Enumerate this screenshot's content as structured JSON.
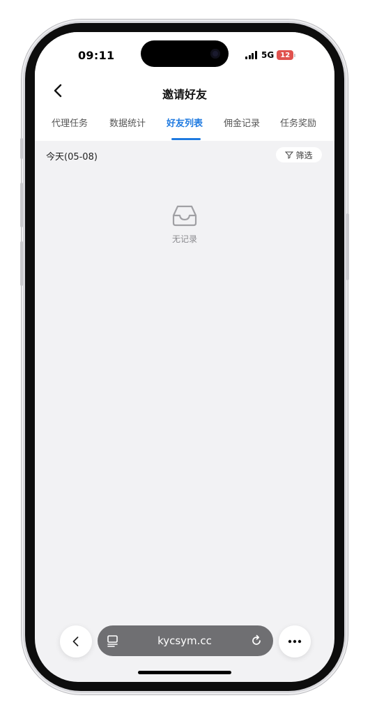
{
  "status_bar": {
    "time": "09:11",
    "network": "5G",
    "battery": "12"
  },
  "header": {
    "title": "邀请好友"
  },
  "tabs": [
    {
      "label": "代理任务"
    },
    {
      "label": "数据统计"
    },
    {
      "label": "好友列表",
      "active": true
    },
    {
      "label": "佣金记录"
    },
    {
      "label": "任务奖励"
    }
  ],
  "filter_row": {
    "date": "今天(05-08)",
    "filter_label": "筛选"
  },
  "empty_state": {
    "text": "无记录",
    "icon": "inbox-tray-icon"
  },
  "browser_bar": {
    "url": "kycsym.cc"
  },
  "colors": {
    "accent": "#1f7ae0",
    "battery": "#e0524e",
    "background": "#f2f2f4"
  }
}
